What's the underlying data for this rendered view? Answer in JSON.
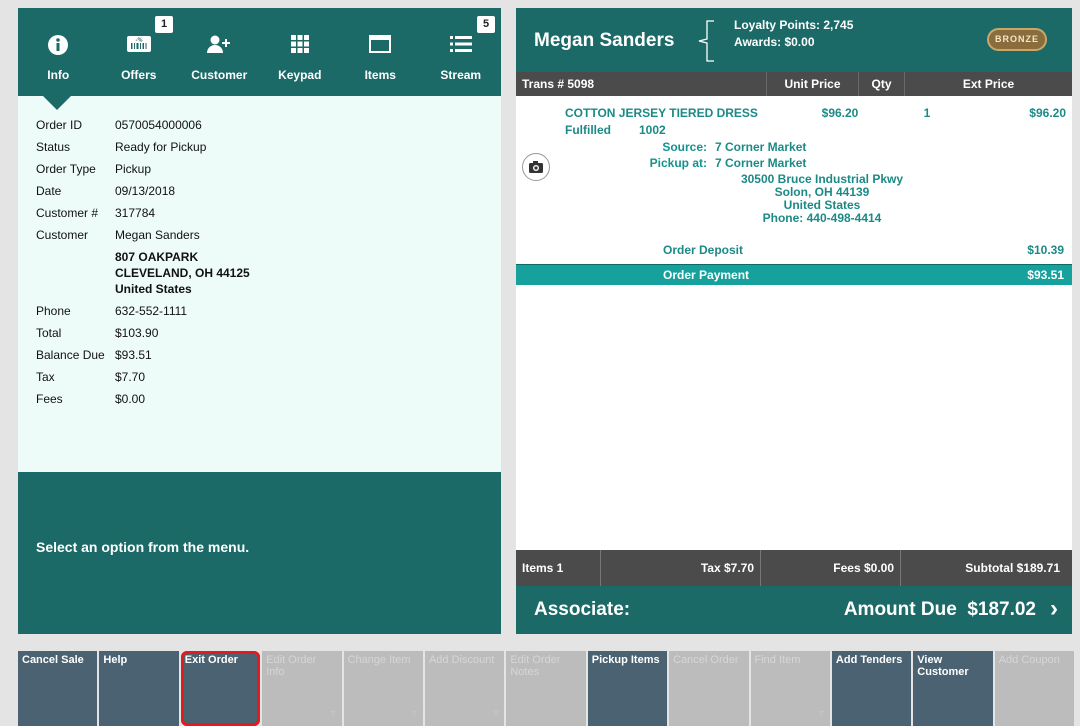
{
  "tabs": [
    {
      "label": "Info",
      "icon": "info-icon",
      "badge": ""
    },
    {
      "label": "Offers",
      "icon": "coupon-icon",
      "badge": "1"
    },
    {
      "label": "Customer",
      "icon": "add-customer-icon",
      "badge": ""
    },
    {
      "label": "Keypad",
      "icon": "keypad-icon",
      "badge": ""
    },
    {
      "label": "Items",
      "icon": "items-icon",
      "badge": ""
    },
    {
      "label": "Stream",
      "icon": "stream-icon",
      "badge": "5"
    }
  ],
  "details": {
    "order_id": {
      "label": "Order ID",
      "value": "0570054000006"
    },
    "status": {
      "label": "Status",
      "value": "Ready for Pickup"
    },
    "order_type": {
      "label": "Order Type",
      "value": "Pickup"
    },
    "date": {
      "label": "Date",
      "value": "09/13/2018"
    },
    "customer_num": {
      "label": "Customer #",
      "value": "317784"
    },
    "customer": {
      "label": "Customer",
      "value": "Megan Sanders"
    },
    "address": [
      "807 OAKPARK",
      "CLEVELAND, OH 44125",
      "United States"
    ],
    "phone": {
      "label": "Phone",
      "value": "632-552-1111"
    },
    "total": {
      "label": "Total",
      "value": "$103.90"
    },
    "balance_due": {
      "label": "Balance Due",
      "value": "$93.51"
    },
    "tax": {
      "label": "Tax",
      "value": "$7.70"
    },
    "fees": {
      "label": "Fees",
      "value": "$0.00"
    }
  },
  "message": "Select an option from the menu.",
  "header": {
    "customer_name": "Megan Sanders",
    "loyalty_points": "Loyalty Points: 2,745",
    "awards": "Awards: $0.00",
    "tier_badge": "BRONZE"
  },
  "table_header": {
    "trans": "Trans # 5098",
    "unit_price": "Unit Price",
    "qty": "Qty",
    "ext_price": "Ext Price"
  },
  "line_item": {
    "name": "COTTON JERSEY TIERED DRESS",
    "unit_price": "$96.20",
    "qty": "1",
    "ext_price": "$96.20",
    "status": "Fulfilled",
    "status_code": "1002",
    "source_label": "Source:",
    "source_value": "7 Corner Market",
    "pickup_label": "Pickup at:",
    "pickup_value": "7 Corner Market",
    "pickup_address": [
      "30500 Bruce Industrial Pkwy",
      "Solon, OH 44139",
      "United States",
      "Phone: 440-498-4414"
    ]
  },
  "order_deposit": {
    "label": "Order Deposit",
    "value": "$10.39"
  },
  "order_payment": {
    "label": "Order Payment",
    "value": "$93.51"
  },
  "totals": {
    "items": "Items 1",
    "tax": "Tax $7.70",
    "fees": "Fees $0.00",
    "subtotal": "Subtotal $189.71"
  },
  "associate": {
    "label": "Associate:",
    "amount_due": "Amount Due  $187.02",
    "chevron": "›"
  },
  "buttons": [
    {
      "label": "Cancel Sale",
      "enabled": true
    },
    {
      "label": "Help",
      "enabled": true
    },
    {
      "label": "Exit Order",
      "enabled": true,
      "highlighted": true
    },
    {
      "label": "Edit Order Info",
      "enabled": false
    },
    {
      "label": "Change Item",
      "enabled": false
    },
    {
      "label": "Add Discount",
      "enabled": false
    },
    {
      "label": "Edit Order Notes",
      "enabled": false
    },
    {
      "label": "Pickup Items",
      "enabled": true
    },
    {
      "label": "Cancel Order",
      "enabled": false
    },
    {
      "label": "Find Item",
      "enabled": false
    },
    {
      "label": "Add Tenders",
      "enabled": true
    },
    {
      "label": "View Customer",
      "enabled": true
    },
    {
      "label": "Add Coupon",
      "enabled": false
    }
  ],
  "colors": {
    "teal_dark": "#1b6a67",
    "teal_bright": "#16a19c",
    "panel_bg": "#eefcf9",
    "button_slate": "#4a6272",
    "highlight_red": "#e51a1a"
  }
}
